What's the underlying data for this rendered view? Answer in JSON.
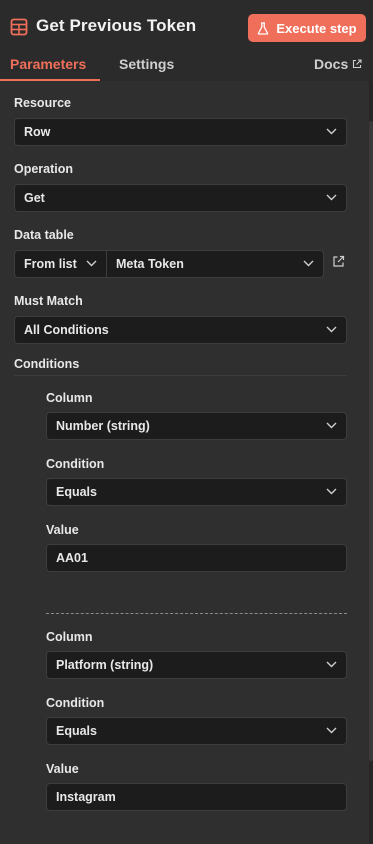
{
  "header": {
    "title": "Get Previous Token",
    "execute_label": "Execute step",
    "icon": "table-icon",
    "accent": "#ef6f5a"
  },
  "tabs": {
    "parameters": "Parameters",
    "settings": "Settings",
    "docs": "Docs"
  },
  "form": {
    "resource": {
      "label": "Resource",
      "value": "Row"
    },
    "operation": {
      "label": "Operation",
      "value": "Get"
    },
    "data_table": {
      "label": "Data table",
      "mode": "From list",
      "value": "Meta Token"
    },
    "must_match": {
      "label": "Must Match",
      "value": "All Conditions"
    },
    "conditions_label": "Conditions",
    "conditions": [
      {
        "column_label": "Column",
        "column": "Number (string)",
        "condition_label": "Condition",
        "condition": "Equals",
        "value_label": "Value",
        "value": "AA01"
      },
      {
        "column_label": "Column",
        "column": "Platform (string)",
        "condition_label": "Condition",
        "condition": "Equals",
        "value_label": "Value",
        "value": "Instagram"
      }
    ]
  }
}
